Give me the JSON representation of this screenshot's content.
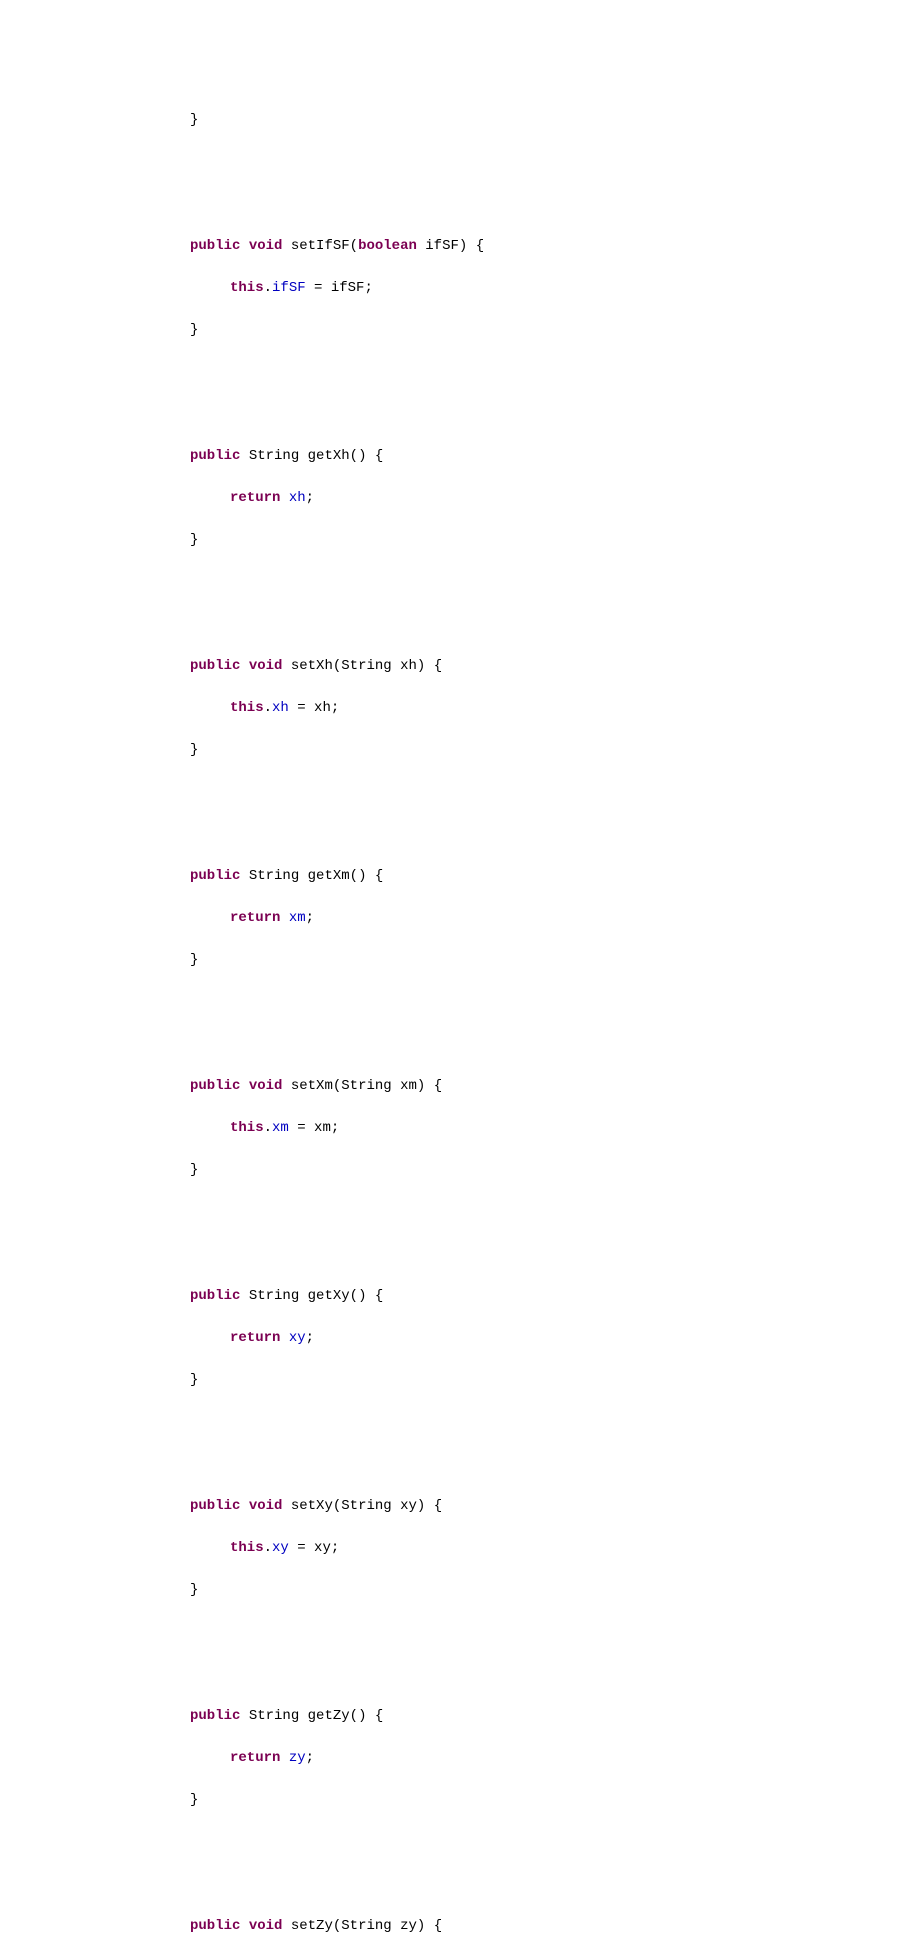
{
  "code": {
    "kw_public": "public",
    "kw_void": "void",
    "kw_boolean": "boolean",
    "kw_this": "this",
    "kw_return": "return",
    "type_String": "String",
    "m_setIfSF": "setIfSF",
    "m_getXh": "getXh",
    "m_setXh": "setXh",
    "m_getXm": "getXm",
    "m_setXm": "setXm",
    "m_getXy": "getXy",
    "m_setXy": "setXy",
    "m_getZy": "getZy",
    "m_setZy": "setZy",
    "p_ifSF": "ifSF",
    "p_xh": "xh",
    "p_xm": "xm",
    "p_xy": "xy",
    "p_zy": "zy",
    "f_ifSF": "ifSF",
    "f_xh": "xh",
    "f_xm": "xm",
    "f_xy": "xy",
    "f_zy": "zy",
    "brace_open": "{",
    "brace_close": "}",
    "paren_open": "(",
    "paren_close": ")",
    "semi": ";",
    "dot": ".",
    "eq": " = ",
    "sp": " "
  }
}
